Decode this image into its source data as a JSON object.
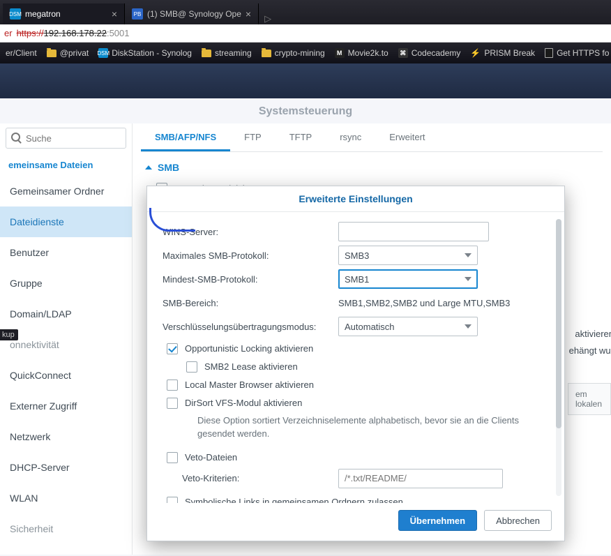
{
  "browser": {
    "tabs": [
      {
        "label": "megatron",
        "favicon": "DSM"
      },
      {
        "label": "(1) SMB@ Synology Ope",
        "favicon": "PB"
      }
    ],
    "address": {
      "warn": "er",
      "https": "https://",
      "host": "192.168.178.22",
      "port": ":5001"
    },
    "bookmarks": [
      {
        "kind": "text",
        "label": "er/Client"
      },
      {
        "kind": "folder",
        "label": "@privat"
      },
      {
        "kind": "dsm",
        "label": "DiskStation - Synolog"
      },
      {
        "kind": "folder",
        "label": "streaming"
      },
      {
        "kind": "folder",
        "label": "crypto-mining"
      },
      {
        "kind": "letter",
        "letter": "M",
        "label": "Movie2k.to"
      },
      {
        "kind": "icon",
        "label": "Codecademy"
      },
      {
        "kind": "bolt",
        "label": "PRISM Break"
      },
      {
        "kind": "page",
        "label": "Get HTTPS fo"
      }
    ]
  },
  "app": {
    "title": "Systemsteuerung",
    "search_placeholder": "Suche",
    "sidebar": {
      "category": "emeinsame Dateien",
      "items": [
        "Gemeinsamer Ordner",
        "Dateidienste",
        "Benutzer",
        "Gruppe",
        "Domain/LDAP",
        "onnektivität",
        "QuickConnect",
        "Externer Zugriff",
        "Netzwerk",
        "DHCP-Server",
        "WLAN",
        "Sicherheit"
      ],
      "active_index": 1,
      "badge": "kup"
    },
    "tabs": [
      "SMB/AFP/NFS",
      "FTP",
      "TFTP",
      "rsync",
      "Erweitert"
    ],
    "active_tab": 0,
    "section": "SMB",
    "smb_checkbox": "SMB-Dienst aktivieren",
    "bg_hint1": "aktivieren",
    "bg_hint2": "ehängt wur",
    "bg_box": "em lokalen"
  },
  "modal": {
    "title": "Erweiterte Einstellungen",
    "rows": {
      "wins_label": "WINS-Server:",
      "max_label": "Maximales SMB-Protokoll:",
      "max_value": "SMB3",
      "min_label": "Mindest-SMB-Protokoll:",
      "min_value": "SMB1",
      "range_label": "SMB-Bereich:",
      "range_value": "SMB1,SMB2,SMB2 und Large MTU,SMB3",
      "enc_label": "Verschlüsselungsübertragungsmodus:",
      "enc_value": "Automatisch"
    },
    "checks": {
      "oplock": "Opportunistic Locking aktivieren",
      "smb2lease": "SMB2 Lease aktivieren",
      "lmb": "Local Master Browser aktivieren",
      "dirsort": "DirSort VFS-Modul aktivieren",
      "dirsort_help": "Diese Option sortiert Verzeichniselemente alphabetisch, bevor sie an die Clients gesendet werden.",
      "veto": "Veto-Dateien",
      "veto_label": "Veto-Kriterien:",
      "veto_placeholder": "/*.txt/README/",
      "symlinks": "Symbolische Links in gemeinsamen Ordnern zulassen"
    },
    "buttons": {
      "apply": "Übernehmen",
      "cancel": "Abbrechen"
    }
  }
}
